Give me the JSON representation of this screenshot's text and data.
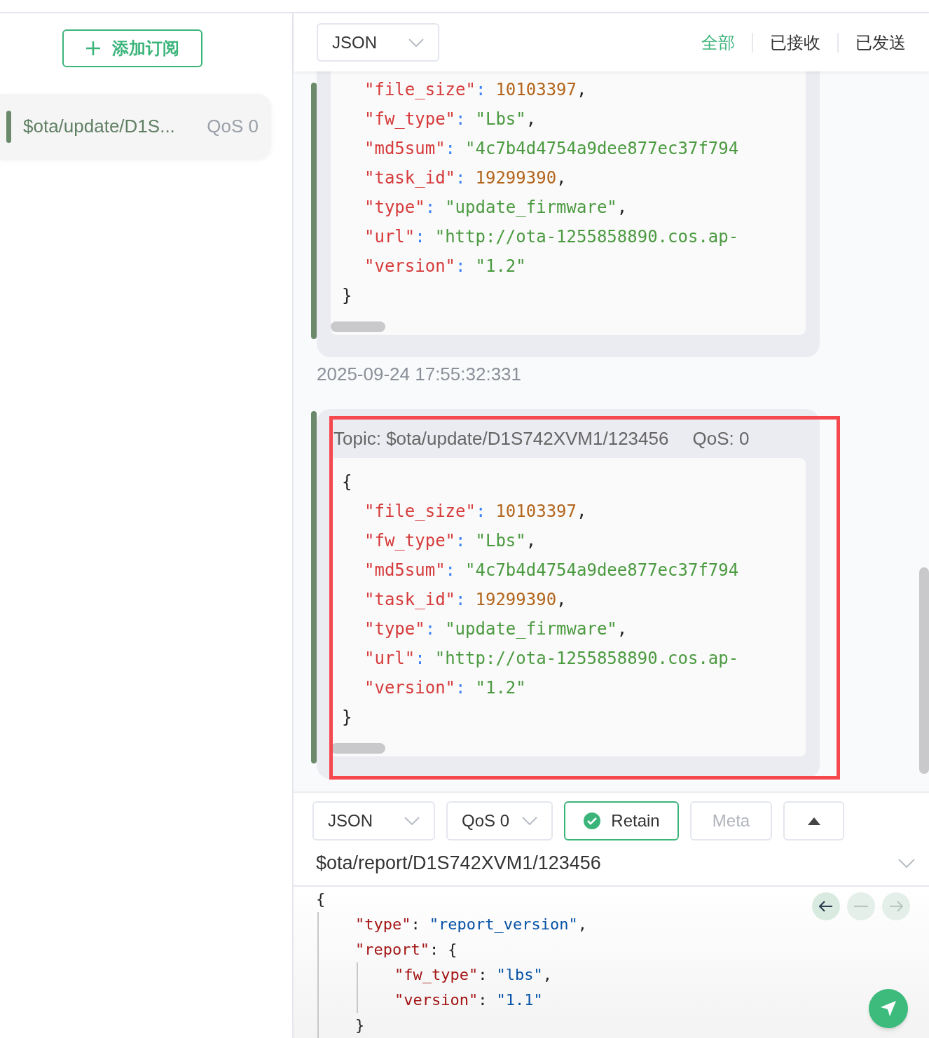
{
  "sidebar": {
    "add_button": {
      "label": "添加订阅"
    },
    "subscriptions": [
      {
        "topic": "$ota/update/D1S...",
        "qos": "QoS 0",
        "color": "#6b8a6b"
      }
    ]
  },
  "header": {
    "format": "JSON",
    "filters": [
      {
        "label": "全部",
        "selected": true
      },
      {
        "label": "已接收",
        "selected": false
      },
      {
        "label": "已发送",
        "selected": false
      }
    ]
  },
  "messages": [
    {
      "fields": [
        {
          "key": "\"file_size\"",
          "sep": ":",
          "value": "10103397",
          "kind": "number",
          "end": ","
        },
        {
          "key": "\"fw_type\"",
          "sep": ":",
          "value": "\"Lbs\"",
          "kind": "string",
          "end": ","
        },
        {
          "key": "\"md5sum\"",
          "sep": ":",
          "value": "\"4c7b4d4754a9dee877ec37f794",
          "kind": "string"
        },
        {
          "key": "\"task_id\"",
          "sep": ":",
          "value": "19299390",
          "kind": "number",
          "end": ","
        },
        {
          "key": "\"type\"",
          "sep": ":",
          "value": "\"update_firmware\"",
          "kind": "string",
          "end": ","
        },
        {
          "key": "\"url\"",
          "sep": ":",
          "value": "\"http://ota-1255858890.cos.ap-",
          "kind": "string"
        },
        {
          "key": "\"version\"",
          "sep": ":",
          "value": "\"1.2\"",
          "kind": "string"
        }
      ],
      "close": "}",
      "time": "2025-09-24 17:55:32:331"
    },
    {
      "topic": "Topic: $ota/update/D1S742XVM1/123456",
      "qos": "QoS: 0",
      "open": "{",
      "fields": [
        {
          "key": "\"file_size\"",
          "sep": ":",
          "value": "10103397",
          "kind": "number",
          "end": ","
        },
        {
          "key": "\"fw_type\"",
          "sep": ":",
          "value": "\"Lbs\"",
          "kind": "string",
          "end": ","
        },
        {
          "key": "\"md5sum\"",
          "sep": ":",
          "value": "\"4c7b4d4754a9dee877ec37f794",
          "kind": "string"
        },
        {
          "key": "\"task_id\"",
          "sep": ":",
          "value": "19299390",
          "kind": "number",
          "end": ","
        },
        {
          "key": "\"type\"",
          "sep": ":",
          "value": "\"update_firmware\"",
          "kind": "string",
          "end": ","
        },
        {
          "key": "\"url\"",
          "sep": ":",
          "value": "\"http://ota-1255858890.cos.ap-",
          "kind": "string"
        },
        {
          "key": "\"version\"",
          "sep": ":",
          "value": "\"1.2\"",
          "kind": "string"
        }
      ],
      "close": "}"
    }
  ],
  "composer": {
    "format": "JSON",
    "qos": "QoS 0",
    "retain": {
      "label": "Retain",
      "on": true
    },
    "meta": {
      "label": "Meta",
      "on": false
    },
    "topic": "$ota/report/D1S742XVM1/123456",
    "history": [
      {
        "kind": "back",
        "disabled": false
      },
      {
        "kind": "clear",
        "disabled": true
      },
      {
        "kind": "forward",
        "disabled": true
      }
    ],
    "payload": {
      "open": "{",
      "fields": [
        {
          "key": "\"type\"",
          "sep": ":",
          "value": "\"report_version\"",
          "end": ","
        },
        {
          "key": "\"report\"",
          "sep": ":",
          "open": "{",
          "children": [
            {
              "key": "\"fw_type\"",
              "sep": ":",
              "value": "\"lbs\"",
              "end": ","
            },
            {
              "key": "\"version\"",
              "sep": ":",
              "value": "\"1.1\""
            }
          ],
          "close": "}"
        }
      ]
    }
  }
}
